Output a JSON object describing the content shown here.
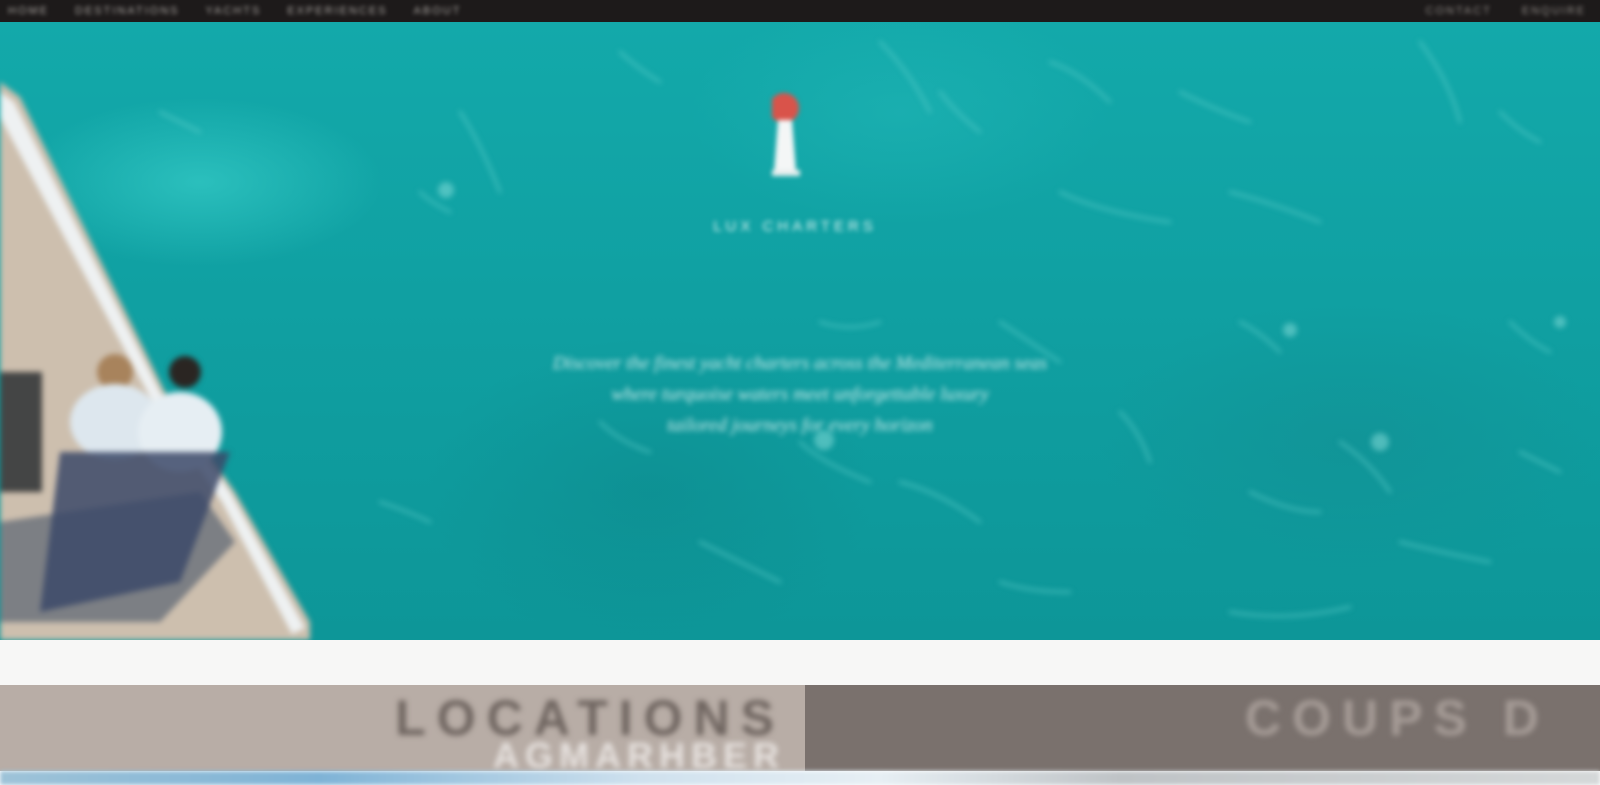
{
  "topbar": {
    "nav": [
      "Home",
      "Destinations",
      "Yachts",
      "Experiences",
      "About"
    ],
    "right": [
      "Contact",
      "Enquire"
    ]
  },
  "hero": {
    "brand": "Lux Charters",
    "tagline_lines": [
      "Discover the finest yacht charters across the Mediterranean seas",
      "where turquoise waters meet unforgettable luxury",
      "tailored journeys for every horizon"
    ],
    "logo_icon": "lighthouse-icon"
  },
  "panels": {
    "left": {
      "title": "LOCATIONS",
      "subtitle": "AGMARHBER"
    },
    "right": {
      "title": "COUPS D"
    }
  },
  "colors": {
    "sea": "#10a0a2",
    "panel_left": "#b8ada6",
    "panel_right": "#7a716d",
    "topbar": "#1d1a1a"
  }
}
